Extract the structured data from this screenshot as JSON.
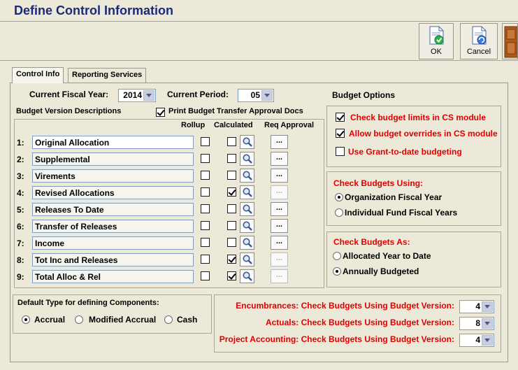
{
  "window": {
    "title": "Define Control Information"
  },
  "toolbar": {
    "ok_label": "OK",
    "cancel_label": "Cancel"
  },
  "tabs": [
    {
      "label": "Control Info"
    },
    {
      "label": "Reporting Services"
    }
  ],
  "header": {
    "fiscal_year_label": "Current Fiscal Year:",
    "fiscal_year_value": "2014",
    "period_label": "Current Period:",
    "period_value": "05",
    "budget_version_label": "Budget Version Descriptions",
    "print_docs_label": "Print Budget Transfer Approval Docs",
    "print_docs_checked": true
  },
  "columns": {
    "rollup": "Rollup",
    "calculated": "Calculated",
    "req_approval": "Req Approval"
  },
  "versions": [
    {
      "num": "1:",
      "desc": "Original Allocation",
      "rollup": false,
      "calculated": false,
      "approval_enabled": true
    },
    {
      "num": "2:",
      "desc": "Supplemental",
      "rollup": false,
      "calculated": false,
      "approval_enabled": true
    },
    {
      "num": "3:",
      "desc": "Virements",
      "rollup": false,
      "calculated": false,
      "approval_enabled": true
    },
    {
      "num": "4:",
      "desc": "Revised Allocations",
      "rollup": false,
      "calculated": true,
      "approval_enabled": false
    },
    {
      "num": "5:",
      "desc": "Releases To Date",
      "rollup": false,
      "calculated": false,
      "approval_enabled": true
    },
    {
      "num": "6:",
      "desc": "Transfer of Releases",
      "rollup": false,
      "calculated": false,
      "approval_enabled": true
    },
    {
      "num": "7:",
      "desc": "Income",
      "rollup": false,
      "calculated": false,
      "approval_enabled": true
    },
    {
      "num": "8:",
      "desc": "Tot Inc and Releases",
      "rollup": false,
      "calculated": true,
      "approval_enabled": false
    },
    {
      "num": "9:",
      "desc": "Total Alloc & Rel",
      "rollup": false,
      "calculated": true,
      "approval_enabled": false
    }
  ],
  "budget_options": {
    "title": "Budget Options",
    "items": [
      {
        "label": "Check budget limits in CS module",
        "checked": true
      },
      {
        "label": "Allow budget overrides in CS module",
        "checked": true
      },
      {
        "label": "Use Grant-to-date budgeting",
        "checked": false
      }
    ]
  },
  "check_using": {
    "title": "Check Budgets Using:",
    "options": [
      {
        "label": "Organization Fiscal Year",
        "selected": true
      },
      {
        "label": "Individual Fund Fiscal Years",
        "selected": false
      }
    ]
  },
  "check_as": {
    "title": "Check Budgets As:",
    "options": [
      {
        "label": "Allocated Year to Date",
        "selected": false
      },
      {
        "label": "Annually Budgeted",
        "selected": true
      }
    ]
  },
  "components": {
    "title": "Default Type for defining Components:",
    "options": [
      {
        "label": "Accrual",
        "selected": true
      },
      {
        "label": "Modified Accrual",
        "selected": false
      },
      {
        "label": "Cash",
        "selected": false
      }
    ]
  },
  "version_checks": [
    {
      "label": "Encumbrances: Check Budgets Using Budget Version:",
      "value": "4"
    },
    {
      "label": "Actuals: Check Budgets Using Budget Version:",
      "value": "8"
    },
    {
      "label": "Project Accounting: Check Budgets Using Budget Version:",
      "value": "4"
    }
  ],
  "colors": {
    "title": "#1a2a7a",
    "accent_red": "#e00000",
    "background": "#ece9d8"
  }
}
